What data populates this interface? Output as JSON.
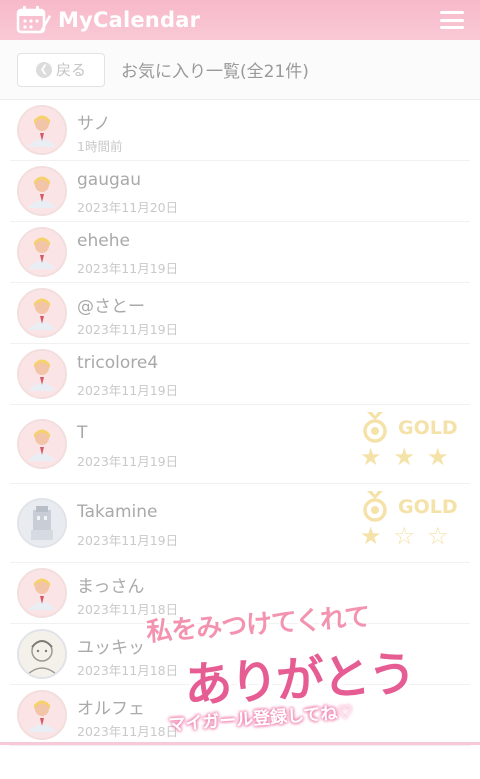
{
  "header": {
    "app_title": "MyCalendar",
    "icons": {
      "logo": "calendar-pencil-icon",
      "menu": "hamburger-icon"
    }
  },
  "subbar": {
    "back_label": "戻る",
    "title": "お気に入り一覧(全21件)"
  },
  "items": [
    {
      "name": "サノ",
      "date": "1時間前",
      "avatar": "default"
    },
    {
      "name": "gaugau",
      "date": "2023年11月20日",
      "avatar": "default"
    },
    {
      "name": "ehehe",
      "date": "2023年11月19日",
      "avatar": "default"
    },
    {
      "name": "@さとー",
      "date": "2023年11月19日",
      "avatar": "default"
    },
    {
      "name": "tricolore4",
      "date": "2023年11月19日",
      "avatar": "default"
    },
    {
      "name": "T",
      "date": "2023年11月19日",
      "avatar": "default",
      "rank": {
        "label": "GOLD",
        "stars_filled": 3,
        "stars_total": 3
      }
    },
    {
      "name": "Takamine",
      "date": "2023年11月19日",
      "avatar": "photo",
      "rank": {
        "label": "GOLD",
        "stars_filled": 1,
        "stars_total": 3
      }
    },
    {
      "name": "まっさん",
      "date": "2023年11月18日",
      "avatar": "default"
    },
    {
      "name": "ユッキッ",
      "date": "2023年11月18日",
      "avatar": "drawn"
    },
    {
      "name": "オルフェ",
      "date": "2023年11月18日",
      "avatar": "default"
    }
  ],
  "overlay": {
    "line1": "私をみつけてくれて",
    "line2": "ありがとう",
    "line3": "マイガール登録してね♡"
  },
  "colors": {
    "header": "#f8c2d0",
    "gold": "#f5e2a9",
    "accent": "#e65d94"
  }
}
